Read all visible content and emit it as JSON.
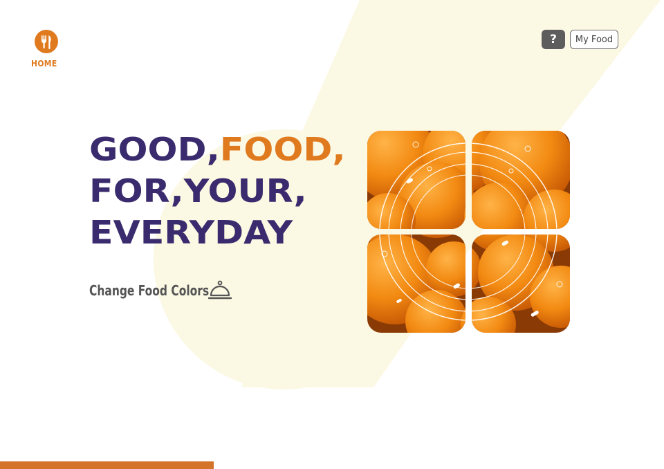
{
  "nav": {
    "home_label": "HOME",
    "home_icon": "fork-knife-icon",
    "help_label": "?",
    "my_food_label": "My Food"
  },
  "hero": {
    "line1_part1": "GOOD,",
    "line1_part2": "FOOD,",
    "line2": "FOR,YOUR,",
    "line3": "EVERYDAY",
    "change_colors_label": "Change Food Colors",
    "change_colors_icon": "cloche-icon"
  },
  "food_image": {
    "subject": "oranges",
    "tiles": 4
  },
  "colors": {
    "accent_orange": "#e07a1f",
    "headline_purple": "#392b6d",
    "background_shape": "#fbf8e3",
    "help_button_bg": "#5d5d5d",
    "bottom_bar": "#d4732a"
  }
}
